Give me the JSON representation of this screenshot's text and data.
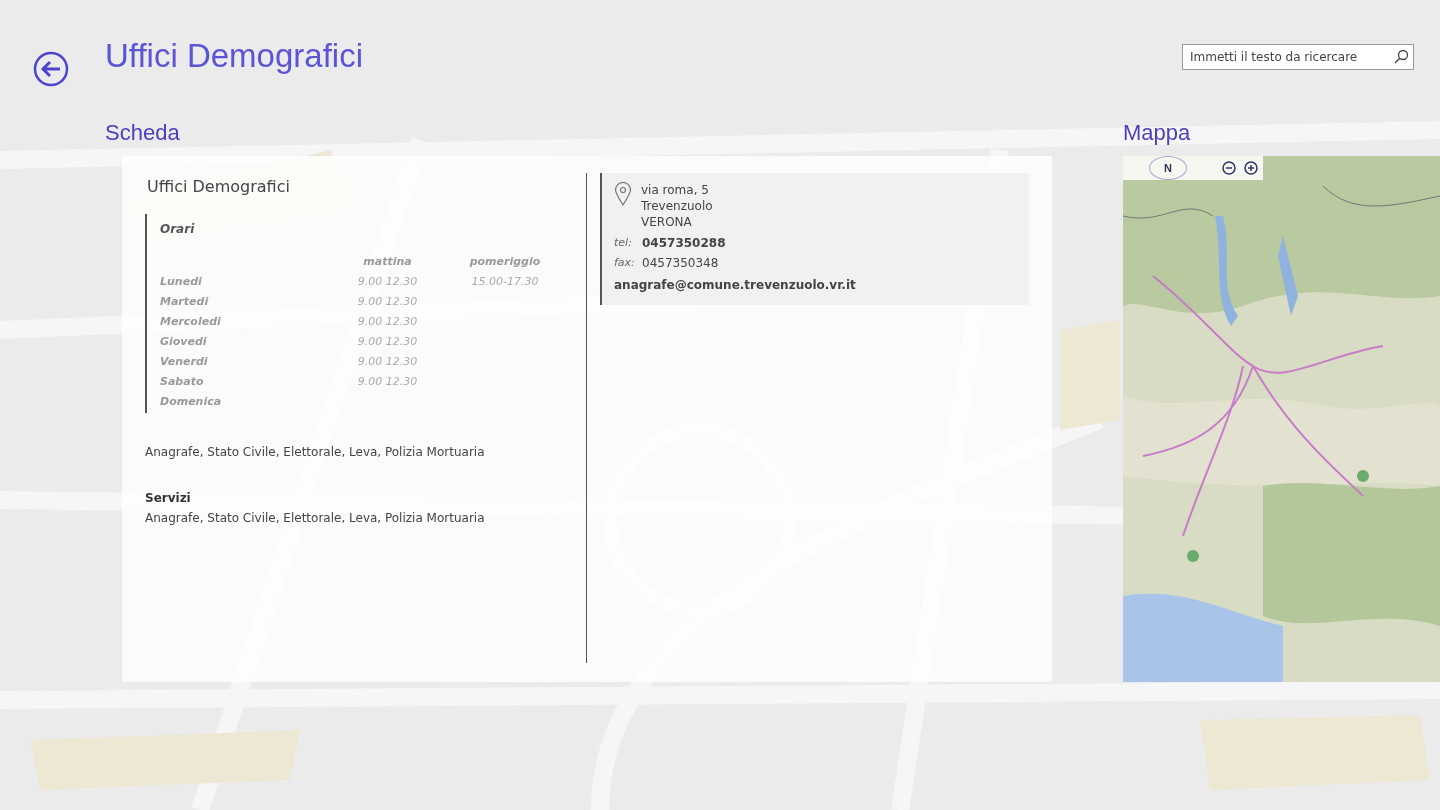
{
  "header": {
    "title": "Uffici Demografici",
    "search": {
      "placeholder": "Immetti il testo da ricercare"
    }
  },
  "card": {
    "heading": "Scheda",
    "title": "Uffici Demografici",
    "hours": {
      "title": "Orari",
      "columns": [
        "mattina",
        "pomeriggio"
      ],
      "rows": [
        {
          "day": "Lunedi",
          "morning": "9.00 12.30",
          "afternoon": "15.00-17.30"
        },
        {
          "day": "Martedi",
          "morning": "9.00 12.30"
        },
        {
          "day": "Mercoledi",
          "morning": "9.00 12.30"
        },
        {
          "day": "Giovedi",
          "morning": "9.00 12.30"
        },
        {
          "day": "Venerdi",
          "morning": "9.00 12.30"
        },
        {
          "day": "Sabato",
          "morning": "9.00 12.30"
        },
        {
          "day": "Domenica"
        }
      ]
    },
    "description": "Anagrafe, Stato Civile, Elettorale, Leva, Polizia Mortuaria",
    "services_title": "Servizi",
    "services": "Anagrafe, Stato Civile, Elettorale, Leva, Polizia Mortuaria",
    "contact": {
      "address": [
        "via roma, 5",
        "Trevenzuolo",
        "VERONA"
      ],
      "tel_label": "tel:",
      "tel": "0457350288",
      "fax_label": "fax:",
      "fax": "0457350348",
      "email": "anagrafe@comune.trevenzuolo.vr.it"
    }
  },
  "map": {
    "heading": "Mappa",
    "kind": "picture",
    "compass": "N"
  }
}
